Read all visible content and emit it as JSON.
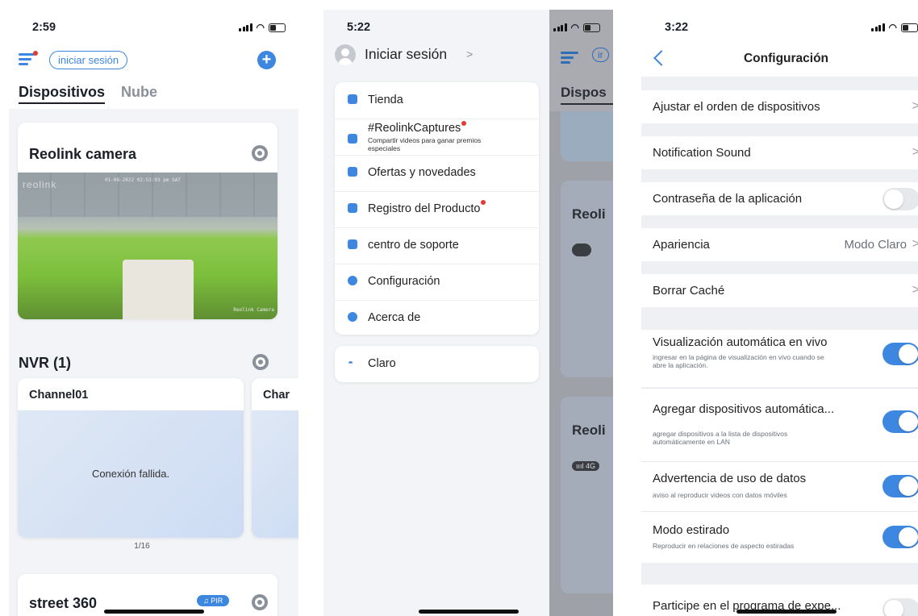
{
  "screen1": {
    "time": "2:59",
    "login_button": "iniciar sesión",
    "tabs": [
      "Dispositivos",
      "Nube"
    ],
    "camera": {
      "title": "Reolink camera",
      "timestamp": "01-08-2022 02:53:03 pm SAT",
      "watermark": "reolink",
      "caption": "Reolink Camera"
    },
    "nvr": {
      "title": "NVR (1)",
      "channel1": "Channel01",
      "channel2": "Char",
      "status": "Conexión fallida.",
      "pager": "1/16"
    },
    "street": {
      "title": "street 360",
      "badge": "PIR"
    }
  },
  "screen2": {
    "time": "5:22",
    "login": "Iniciar sesión",
    "login_chevron": ">",
    "menu": [
      {
        "label": "Tienda",
        "icon": "store-icon"
      },
      {
        "label": "#ReolinkCaptures",
        "sub": "Compartir videos para ganar premios especiales",
        "icon": "video-icon"
      },
      {
        "label": "Ofertas y novedades",
        "icon": "mail-icon"
      },
      {
        "label": "Registro del Producto",
        "icon": "document-icon"
      },
      {
        "label": "centro de soporte",
        "icon": "support-icon"
      },
      {
        "label": "Configuración",
        "icon": "gear-icon"
      },
      {
        "label": "Acerca de",
        "icon": "info-icon"
      }
    ],
    "theme": "Claro",
    "behind": {
      "tab": "Dispos",
      "card1": "Reoli",
      "card2": "Reoli",
      "signal": "ıııl 4G",
      "login_fragment": "ir"
    }
  },
  "screen3": {
    "time": "3:22",
    "title": "Configuración",
    "rows": {
      "order": "Ajustar el orden de dispositivos",
      "sound": "Notification Sound",
      "password": "Contraseña de la aplicación",
      "appearance": "Apariencia",
      "appearance_value": "Modo Claro",
      "cache": "Borrar Caché",
      "autolive": "Visualización automática en vivo",
      "autolive_sub": "ingresar en la  página de visualización en vivo cuando se abre la aplicación.",
      "autoadd": "Agregar dispositivos automática...",
      "autoadd_sub": "agregar dispositivos a la lista de dispositivos automáticamente en LAN",
      "data": "Advertencia de uso de datos",
      "data_sub": "aviso al reproducir videos con datos móviles",
      "stretch": "Modo estirado",
      "stretch_sub": "Reproducir en relaciones de aspecto estiradas",
      "program": "Participe en el programa de expe..."
    },
    "chevron": ">"
  },
  "colors": {
    "accent": "#3d87e0",
    "danger": "#e53935",
    "background": "#f3f4f7"
  }
}
